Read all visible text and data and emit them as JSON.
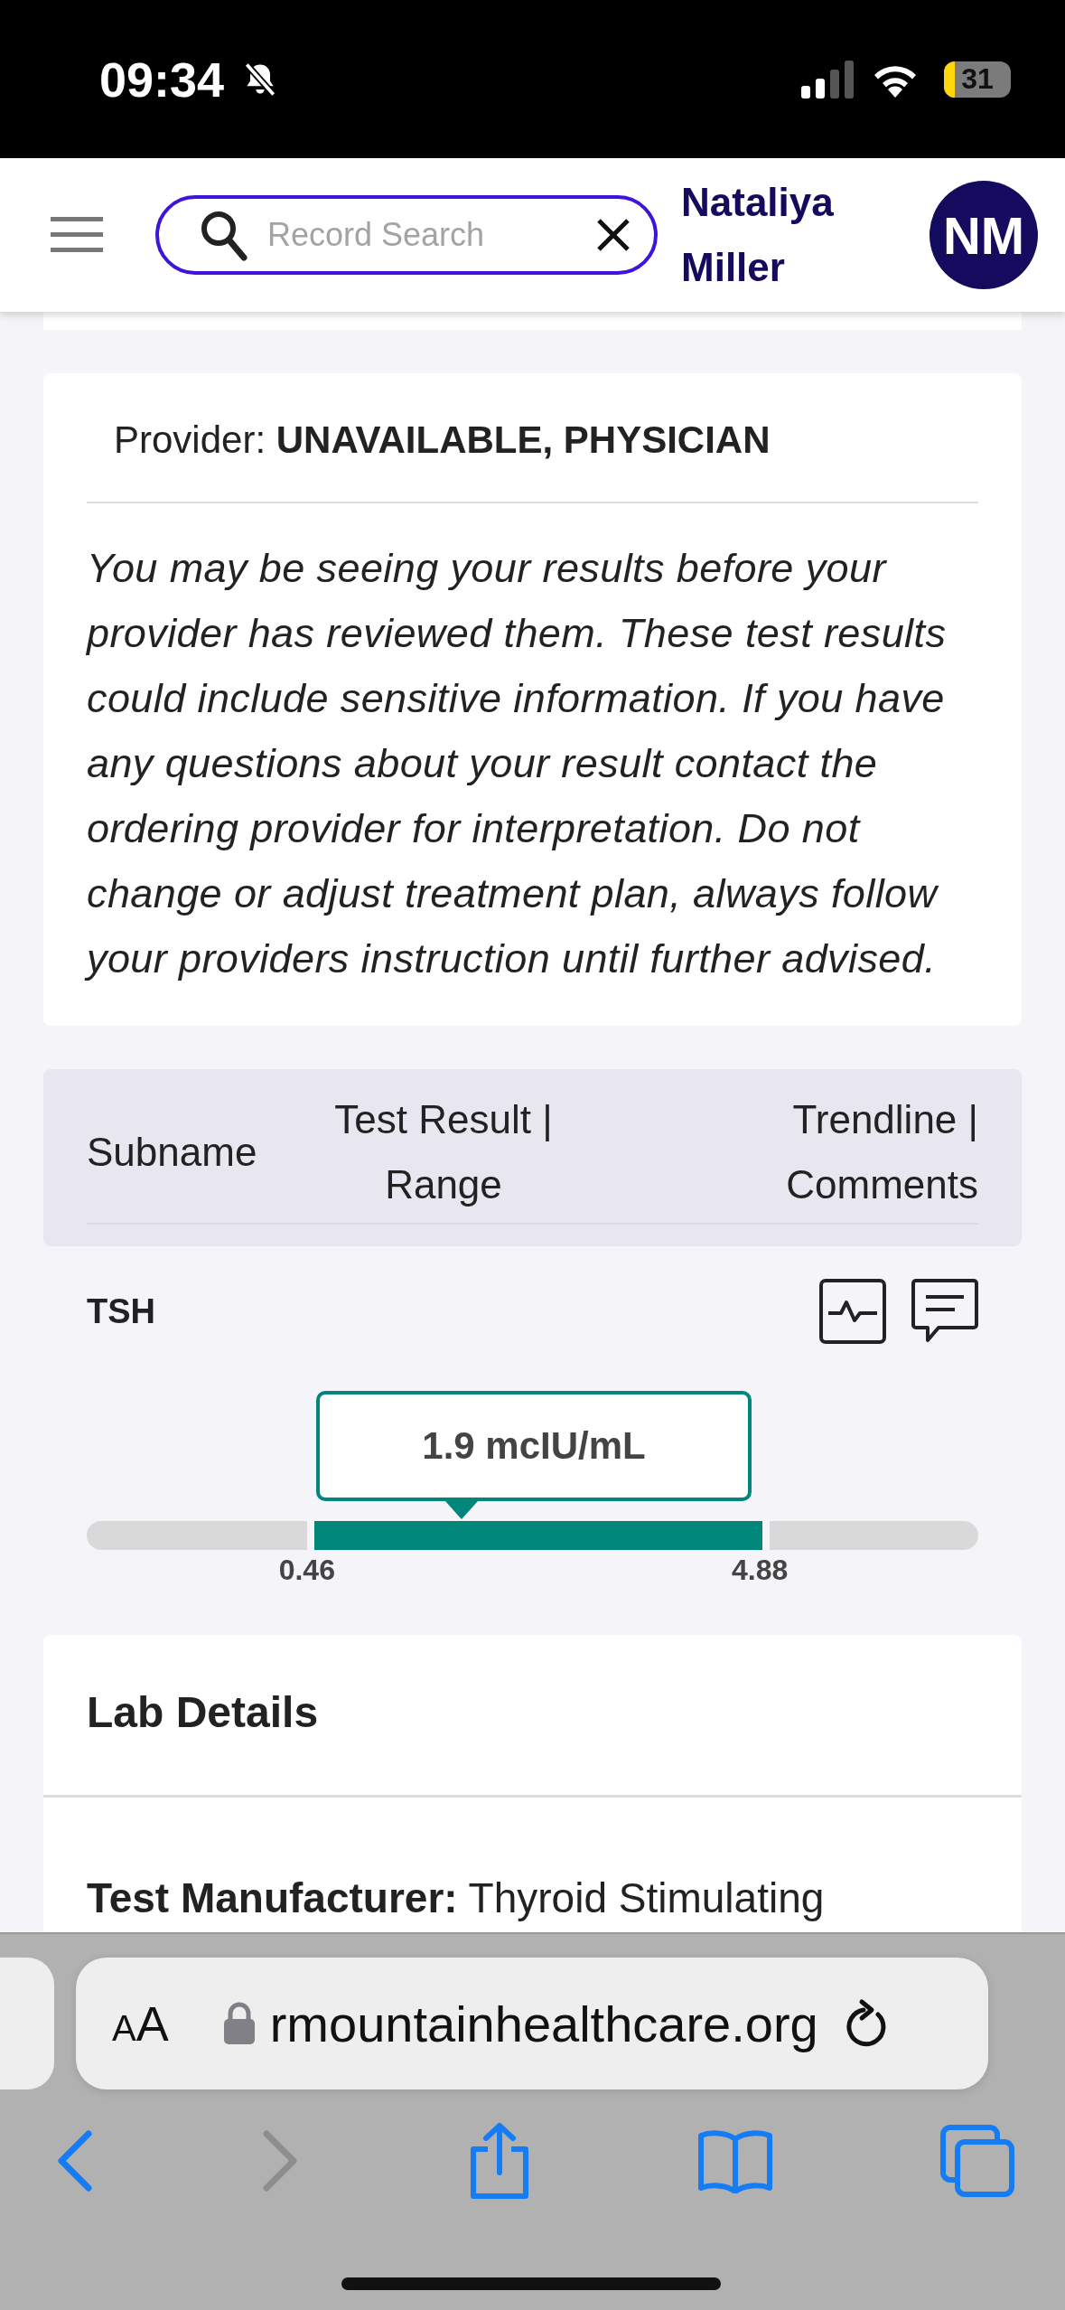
{
  "status_bar": {
    "time": "09:34",
    "silent": true,
    "battery": "31"
  },
  "header": {
    "search": {
      "placeholder": "Record Search"
    },
    "user_name": "Nataliya Miller",
    "avatar_initials": "NM"
  },
  "provider": {
    "label": "Provider:",
    "name": "UNAVAILABLE, PHYSICIAN"
  },
  "disclaimer": "You may be seeing your results before your provider has reviewed them. These test results could include sensitive information. If you have any questions about your result contact the ordering provider for interpretation. Do not change or adjust treatment plan, always follow your providers instruction until further advised.",
  "table": {
    "columns": [
      "Subname",
      "Test Result | Range",
      "Trendline | Comments"
    ],
    "rows": [
      {
        "subname": "TSH",
        "result": "1.9 mcIU/mL",
        "low": "0.46",
        "high": "4.88",
        "level": 0.42
      }
    ]
  },
  "lab_details": {
    "title": "Lab Details",
    "manufacturer": "**Test Manufacturer:** Thyroid Stimulating"
  },
  "browser": {
    "text_size": "AA",
    "url": "rmountainhealthcare.org"
  }
}
